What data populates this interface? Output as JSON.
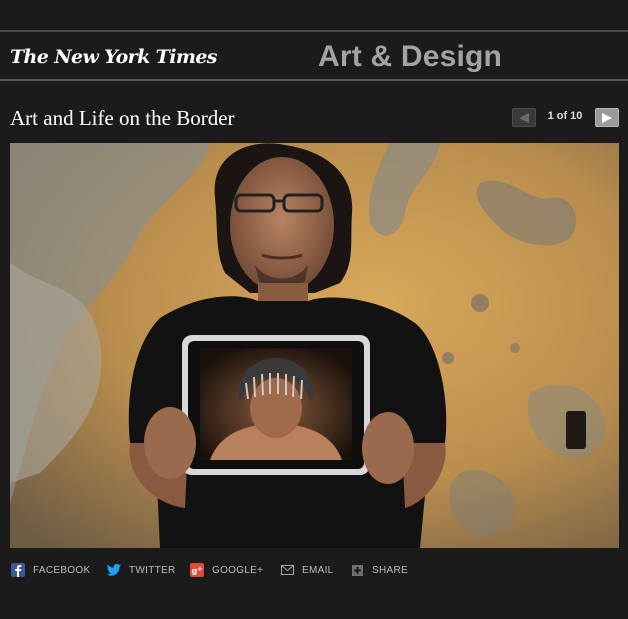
{
  "masthead": {
    "logo_text": "The New York Times",
    "section_title": "Art & Design"
  },
  "gallery": {
    "title": "Art and Life on the Border",
    "counter": "1 of 10",
    "prev_icon": "left-triangle-icon",
    "next_icon": "right-triangle-icon"
  },
  "share": {
    "items": [
      {
        "label": "FACEBOOK",
        "icon": "facebook-icon"
      },
      {
        "label": "TWITTER",
        "icon": "twitter-icon"
      },
      {
        "label": "GOOGLE+",
        "icon": "google-plus-icon"
      },
      {
        "label": "EMAIL",
        "icon": "email-icon"
      },
      {
        "label": "SHARE",
        "icon": "share-plus-icon"
      }
    ]
  },
  "colors": {
    "background": "#1b1b1b",
    "section_title": "#a3a3a3",
    "facebook": "#3b5998",
    "twitter": "#1da1f2",
    "google": "#dd4b39"
  }
}
